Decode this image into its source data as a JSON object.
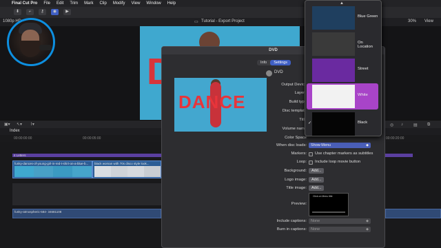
{
  "menubar": {
    "apple": "",
    "app": "Final Cut Pro",
    "items": [
      "File",
      "Edit",
      "Trim",
      "Mark",
      "Clip",
      "Modify",
      "View",
      "Window",
      "Help"
    ]
  },
  "viewer": {
    "format_label": "1080p HD",
    "project_title": "Tutorial - Export Project",
    "zoom": "30%",
    "view_label": "View"
  },
  "timeline": {
    "index_label": "Index",
    "title_clip": "4 Letters",
    "clip1": "funky-dances-of-young-girl-in-red-t-shirt-on-a-blue-b...",
    "clip2": "black woman with 70s disco style look...",
    "audio_clip": "funky-atmospheric-584- 34681108",
    "ruler_times": [
      "00:00:00:00",
      "00:00:05:00",
      "00:00:10:00",
      "00:00:15:00",
      "00:00:20:00"
    ]
  },
  "dialog": {
    "title": "DVD",
    "tabs": [
      "Info",
      "Settings"
    ],
    "active_tab": "Settings",
    "dest_name": "DVD",
    "labels": {
      "output_device": "Output Device",
      "layers": "Layers",
      "build_type": "Build type",
      "disc_template": "Disc template",
      "title": "Title",
      "volume_name": "Volume name",
      "color_space": "Color Space",
      "when_disc_loads": "When disc loads:",
      "markers": "Markers:",
      "loop": "Loop:",
      "background": "Background:",
      "logo_image": "Logo image:",
      "title_image": "Title image:",
      "preview": "Preview:",
      "include_captions": "Include captions:",
      "burn_in_captions": "Burn in captions:"
    },
    "when_disc_loads_value": "Show Menu",
    "markers_option": "Use chapter markers as subtitles",
    "loop_option": "Include loop movie button",
    "add_button": "Add...",
    "include_captions_value": "None",
    "burn_in_captions_value": "None",
    "preview_screen_title": "Click on Menu title"
  },
  "templates": [
    {
      "name": "Blue Green",
      "selected": false,
      "checked": false,
      "color": "#1f3f5f"
    },
    {
      "name": "On Location",
      "selected": false,
      "checked": false,
      "color": "#3a3a3a"
    },
    {
      "name": "Street",
      "selected": false,
      "checked": false,
      "color": "#6a2aa0"
    },
    {
      "name": "White",
      "selected": true,
      "checked": false,
      "color": "#f2f2f2"
    },
    {
      "name": "Black",
      "selected": false,
      "checked": true,
      "color": "#050505"
    }
  ],
  "colors": {
    "accent": "#3f5fc4",
    "selection": "#a844c8",
    "webcam_ring": "#0d8fe0",
    "dance_red": "#e8343a",
    "viewer_blue": "#43a7cf"
  }
}
